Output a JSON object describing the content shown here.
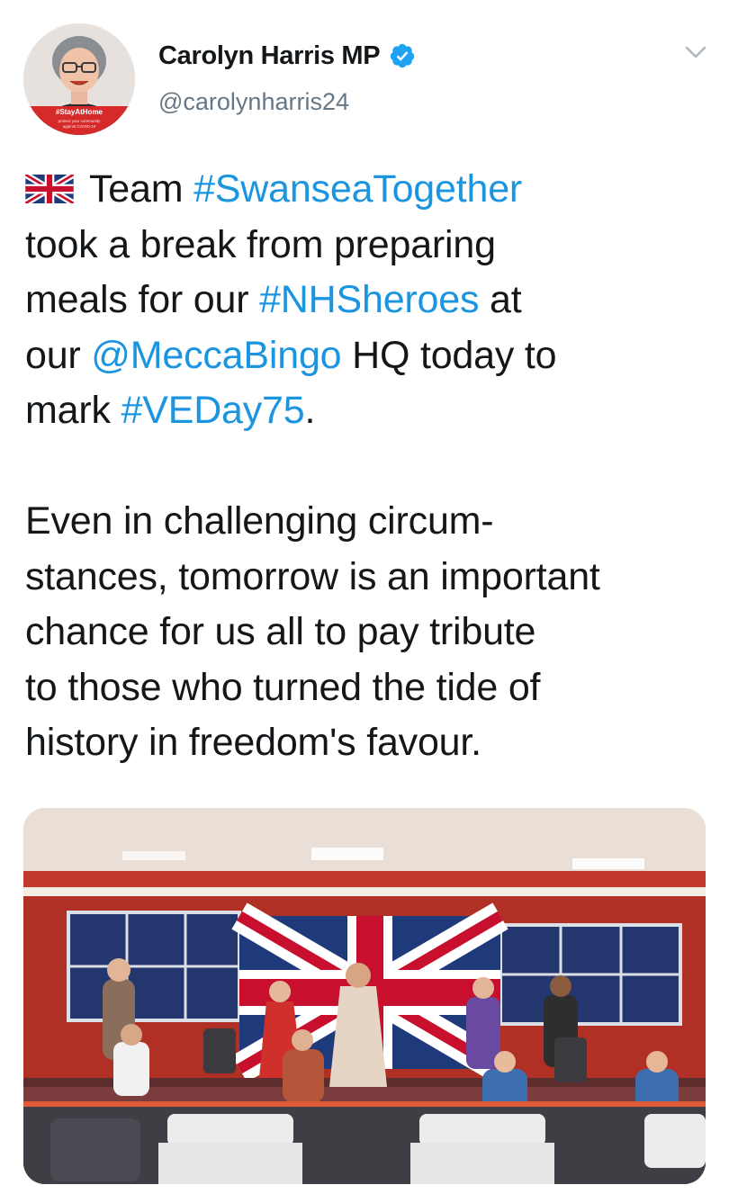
{
  "tweet": {
    "author": {
      "display_name": "Carolyn Harris MP",
      "handle": "@carolynharris24",
      "verified": true,
      "avatar_badge_text": "#StayAtHome",
      "avatar_badge_subtext": "protect your community against COVID-19"
    },
    "menu_icon": "chevron-down-icon",
    "text_lines": [
      [
        {
          "flag": "uk-flag-icon"
        },
        {
          "t": " Team "
        },
        {
          "t": "#SwanseaTogether",
          "link": true
        }
      ],
      [
        {
          "t": "took a break from preparing"
        }
      ],
      [
        {
          "t": "meals for our "
        },
        {
          "t": "#NHSheroes",
          "link": true
        },
        {
          "t": " at"
        }
      ],
      [
        {
          "t": "our "
        },
        {
          "t": "@MeccaBingo",
          "link": true
        },
        {
          "t": " HQ today to"
        }
      ],
      [
        {
          "t": "mark "
        },
        {
          "t": "#VEDay75",
          "link": true
        },
        {
          "t": "."
        }
      ],
      [],
      [
        {
          "t": "Even in challenging circum-"
        }
      ],
      [
        {
          "t": "stances, tomorrow is an important"
        }
      ],
      [
        {
          "t": "chance for us all to pay tribute"
        }
      ],
      [
        {
          "t": "to those who turned the tide of"
        }
      ],
      [
        {
          "t": "history in freedom's favour."
        }
      ]
    ],
    "media": {
      "kind": "photo",
      "subject": "women celebrating VE Day in front of a Union Jack"
    }
  },
  "colors": {
    "link": "#1b95e0",
    "text": "#14171a",
    "secondary": "#657786",
    "verified": "#1da1f2"
  }
}
